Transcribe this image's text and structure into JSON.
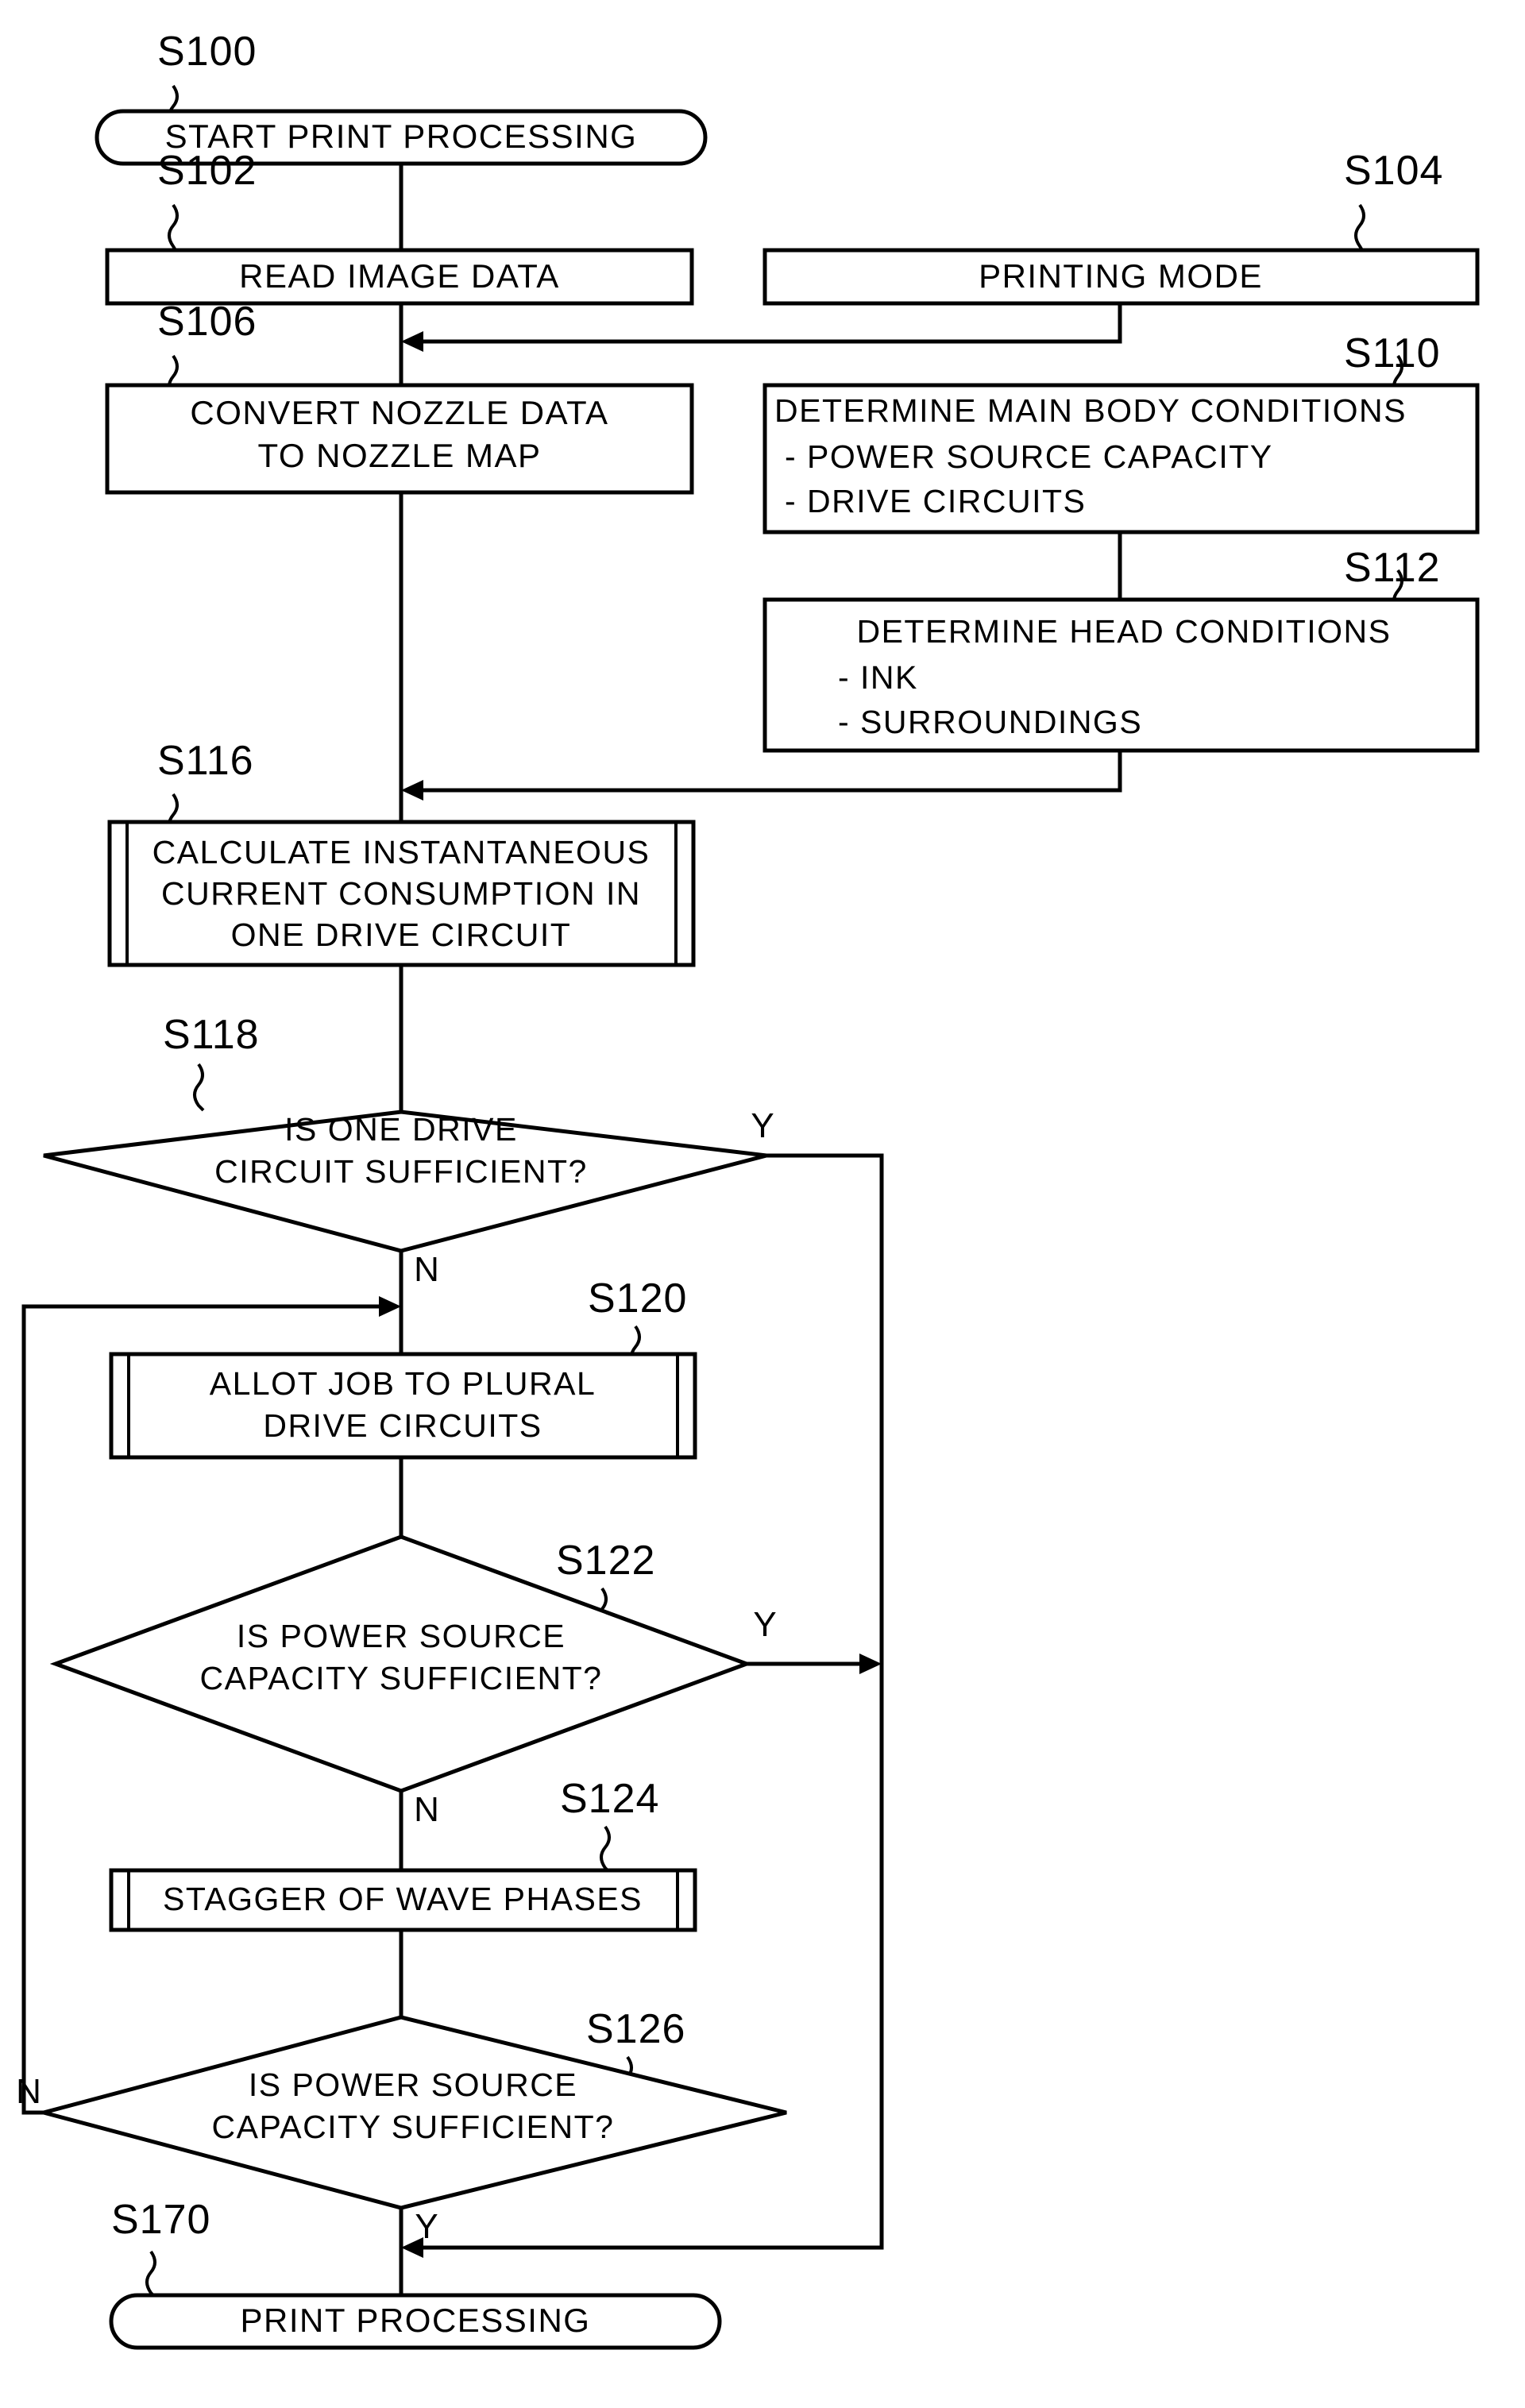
{
  "diagram": {
    "type": "flowchart",
    "title": "Print processing flowchart",
    "background_color": "#ffffff",
    "line_color": "#000000"
  },
  "nodes": {
    "s100": {
      "ref": "S100",
      "shape": "terminator",
      "lines": [
        "START PRINT PROCESSING"
      ]
    },
    "s102": {
      "ref": "S102",
      "shape": "process",
      "lines": [
        "READ IMAGE DATA"
      ]
    },
    "s104": {
      "ref": "S104",
      "shape": "process",
      "lines": [
        "PRINTING MODE"
      ]
    },
    "s106": {
      "ref": "S106",
      "shape": "process",
      "lines": [
        "CONVERT NOZZLE DATA",
        "TO NOZZLE MAP"
      ]
    },
    "s110": {
      "ref": "S110",
      "shape": "process",
      "lines": [
        "DETERMINE MAIN BODY CONDITIONS",
        "- POWER SOURCE CAPACITY",
        "- DRIVE CIRCUITS"
      ]
    },
    "s112": {
      "ref": "S112",
      "shape": "process",
      "lines": [
        "DETERMINE HEAD CONDITIONS",
        "- INK",
        "- SURROUNDINGS"
      ]
    },
    "s116": {
      "ref": "S116",
      "shape": "predefined-process",
      "lines": [
        "CALCULATE INSTANTANEOUS",
        "CURRENT CONSUMPTION IN",
        "ONE DRIVE CIRCUIT"
      ]
    },
    "s118": {
      "ref": "S118",
      "shape": "decision",
      "lines": [
        "IS ONE DRIVE",
        "CIRCUIT SUFFICIENT?"
      ],
      "yes_label": "Y",
      "no_label": "N"
    },
    "s120": {
      "ref": "S120",
      "shape": "predefined-process",
      "lines": [
        "ALLOT JOB TO PLURAL",
        "DRIVE CIRCUITS"
      ]
    },
    "s122": {
      "ref": "S122",
      "shape": "decision",
      "lines": [
        "IS POWER SOURCE",
        "CAPACITY SUFFICIENT?"
      ],
      "yes_label": "Y",
      "no_label": "N"
    },
    "s124": {
      "ref": "S124",
      "shape": "predefined-process",
      "lines": [
        "STAGGER OF WAVE PHASES"
      ]
    },
    "s126": {
      "ref": "S126",
      "shape": "decision",
      "lines": [
        "IS POWER SOURCE",
        "CAPACITY SUFFICIENT?"
      ],
      "yes_label": "Y",
      "no_label": "N"
    },
    "s170": {
      "ref": "S170",
      "shape": "terminator",
      "lines": [
        "PRINT PROCESSING"
      ]
    }
  }
}
